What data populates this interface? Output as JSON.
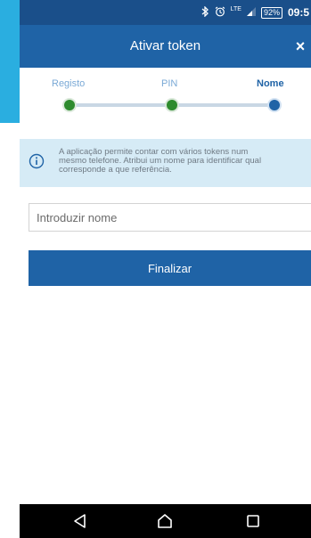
{
  "status_bar": {
    "bluetooth_icon": "bluetooth-icon",
    "alarm_icon": "alarm-icon",
    "network": "LTE",
    "battery": "92%",
    "time": "09:5"
  },
  "app_bar": {
    "title": "Ativar token",
    "close_label": "×"
  },
  "steps": {
    "items": [
      {
        "label": "Registo",
        "state": "done"
      },
      {
        "label": "PIN",
        "state": "done"
      },
      {
        "label": "Nome",
        "state": "active"
      }
    ],
    "colors": {
      "done_dot": "#2e8b2e",
      "active_dot": "#1f63a6",
      "track": "#c9d7e4"
    }
  },
  "info": {
    "icon": "info-icon",
    "line1": "A aplicação permite contar com vários tokens num",
    "line2": "mesmo telefone. Atribui um nome para identificar qual",
    "line3": "corresponde a que referência."
  },
  "form": {
    "name_placeholder": "Introduzir nome",
    "name_value": "",
    "submit_label": "Finalizar"
  },
  "nav": {
    "back_icon": "back-triangle-icon",
    "home_icon": "home-icon",
    "recents_icon": "recents-square-icon"
  },
  "colors": {
    "primary": "#1f63a6",
    "status_bar": "#1a4f8a",
    "info_bg": "#d6ebf6",
    "accent_cyan": "#2aaee0"
  }
}
